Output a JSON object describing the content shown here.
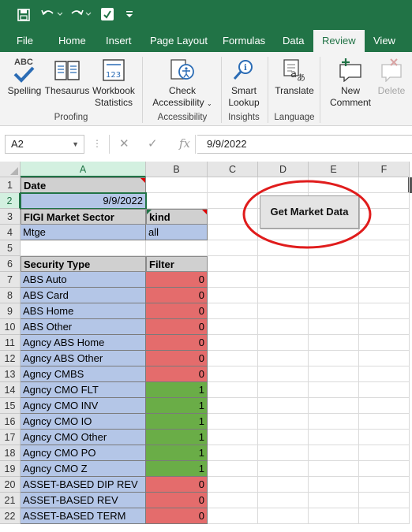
{
  "qat": {
    "icons": [
      "save-icon",
      "undo-icon",
      "redo-icon",
      "touch-mode-icon",
      "customize-qat-icon"
    ]
  },
  "tabs": [
    {
      "label": "File"
    },
    {
      "label": "Home"
    },
    {
      "label": "Insert"
    },
    {
      "label": "Page Layout"
    },
    {
      "label": "Formulas"
    },
    {
      "label": "Data"
    },
    {
      "label": "Review",
      "active": true
    },
    {
      "label": "View"
    }
  ],
  "ribbon": {
    "spelling": "Spelling",
    "thesaurus": "Thesaurus",
    "workbook_stats_1": "Workbook",
    "workbook_stats_2": "Statistics",
    "check_access_1": "Check",
    "check_access_2": "Accessibility",
    "smart_lookup_1": "Smart",
    "smart_lookup_2": "Lookup",
    "translate": "Translate",
    "new_comment_1": "New",
    "new_comment_2": "Comment",
    "delete": "Delete",
    "groups": {
      "proofing": "Proofing",
      "accessibility": "Accessibility",
      "insights": "Insights",
      "language": "Language"
    },
    "abc_glyph": "ABC",
    "calc_glyph": "123"
  },
  "formula_bar": {
    "name_box": "A2",
    "value": "9/9/2022",
    "fx": "fx"
  },
  "columns": [
    "A",
    "B",
    "C",
    "D",
    "E",
    "F"
  ],
  "rows": [
    "1",
    "2",
    "3",
    "4",
    "5",
    "6",
    "7",
    "8",
    "9",
    "10",
    "11",
    "12",
    "13",
    "14",
    "15",
    "16",
    "17",
    "18",
    "19",
    "20",
    "21",
    "22"
  ],
  "sheet": {
    "a1": "Date",
    "a2": "9/9/2022",
    "a3": "FIGI Market Sector",
    "b3": "kind",
    "a4": "Mtge",
    "b4": "all",
    "a6": "Security Type",
    "b6": "Filter",
    "security_rows": [
      {
        "type": "ABS Auto",
        "filter": "0"
      },
      {
        "type": "ABS Card",
        "filter": "0"
      },
      {
        "type": "ABS Home",
        "filter": "0"
      },
      {
        "type": "ABS Other",
        "filter": "0"
      },
      {
        "type": "Agncy ABS Home",
        "filter": "0"
      },
      {
        "type": "Agncy ABS Other",
        "filter": "0"
      },
      {
        "type": "Agncy CMBS",
        "filter": "0"
      },
      {
        "type": "Agncy CMO FLT",
        "filter": "1"
      },
      {
        "type": "Agncy CMO INV",
        "filter": "1"
      },
      {
        "type": "Agncy CMO IO",
        "filter": "1"
      },
      {
        "type": "Agncy CMO Other",
        "filter": "1"
      },
      {
        "type": "Agncy CMO PO",
        "filter": "1"
      },
      {
        "type": "Agncy CMO Z",
        "filter": "1"
      },
      {
        "type": "ASSET-BASED DIP REV",
        "filter": "0"
      },
      {
        "type": "ASSET-BASED REV",
        "filter": "0"
      },
      {
        "type": "ASSET-BASED TERM",
        "filter": "0"
      }
    ]
  },
  "macro_button": "Get Market Data",
  "colors": {
    "excel_green": "#217346",
    "header_grey": "#d0d0d0",
    "cell_blue": "#b4c6e7",
    "filter_red": "#e46c6c",
    "filter_green": "#6aad47",
    "annotation_red": "#e01c1c"
  }
}
